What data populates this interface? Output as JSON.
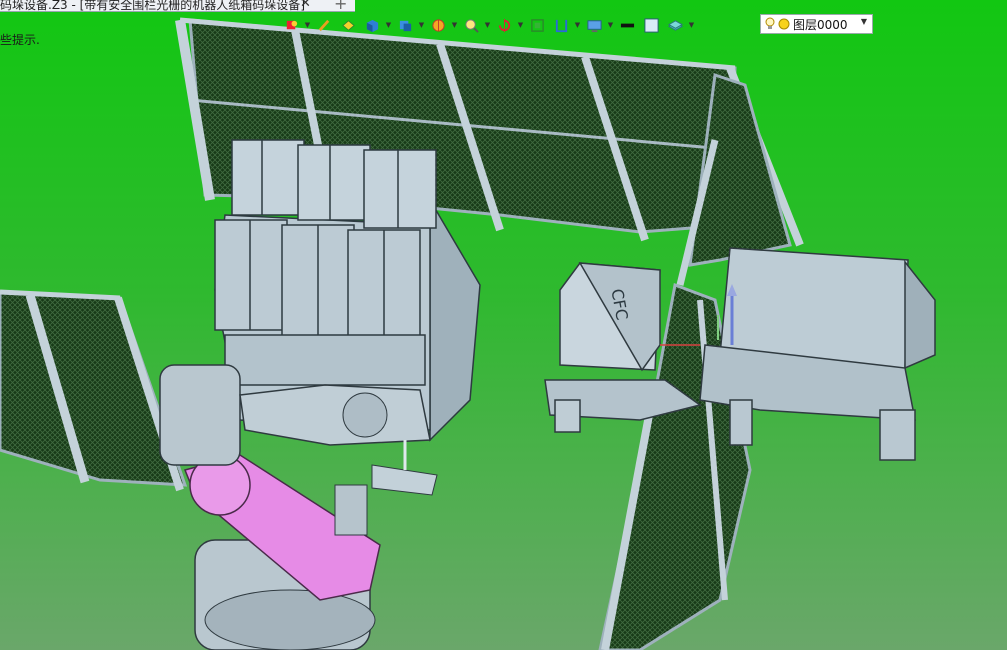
{
  "window": {
    "title": "码垛设备.Z3 - [带有安全围栏光栅的机器人纸箱码垛设备]",
    "close_glyph": "✕",
    "new_tab_glyph": "+"
  },
  "hint": "些提示.",
  "toolbar": {
    "icons": [
      "light-icon",
      "brush-icon",
      "shading-icon",
      "cube-icon",
      "view-cube-icon",
      "color-wheel-icon",
      "zoom-icon",
      "rotate-icon",
      "frame-icon",
      "section-icon",
      "display-icon",
      "black-rect-icon",
      "box-outline-icon",
      "layers-icon"
    ]
  },
  "layer": {
    "label": "图层0000",
    "arrow": "▼"
  },
  "scene": {
    "box_label": "CFC"
  },
  "colors": {
    "bg_top": "#12c712",
    "bg_bottom": "#6aa76a",
    "metal": "#bcccd5",
    "metal_dark": "#7d8c95",
    "arm_pink": "#e68be6",
    "toolbar_bg": "#eef1f5"
  }
}
